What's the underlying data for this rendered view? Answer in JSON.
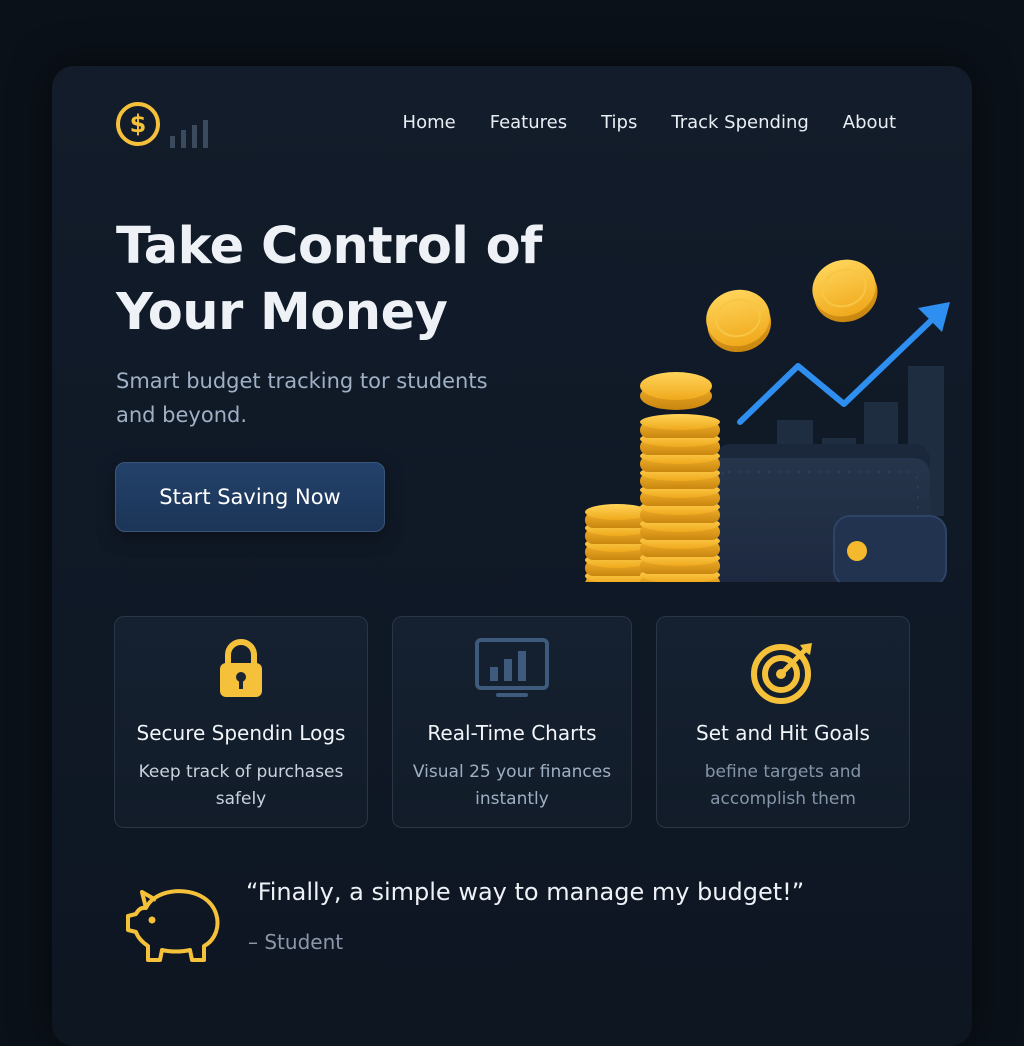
{
  "nav": {
    "items": [
      {
        "label": "Home"
      },
      {
        "label": "Features"
      },
      {
        "label": "Tips"
      },
      {
        "label": "Track Spending"
      },
      {
        "label": "About"
      }
    ]
  },
  "logo": {
    "icon": "dollar-coin-icon",
    "bars_icon": "signal-bars-icon"
  },
  "hero": {
    "title": "Take Control of Your Money",
    "subtitle": "Smart budget tracking tor students and beyond.",
    "cta_label": "Start Saving Now",
    "illustration": "coins-wallet-growth-illustration"
  },
  "features": [
    {
      "icon": "padlock-icon",
      "title": "Secure Spendin Logs",
      "description": "Keep track of purchases safely"
    },
    {
      "icon": "bar-chart-monitor-icon",
      "title": "Real-Time Charts",
      "description": "Visual 25 your finances instantly"
    },
    {
      "icon": "target-icon",
      "title": "Set and Hit Goals",
      "description": "befine targets and accomplish them"
    }
  ],
  "testimonial": {
    "icon": "piggy-bank-icon",
    "quote": "“Finally, a simple way to manage my budget!”",
    "author": "– Student"
  },
  "colors": {
    "accent_gold": "#f5c13b",
    "button_blue": "#1f3b62",
    "chart_blue": "#2f8ff0",
    "background": "#0f1825"
  }
}
